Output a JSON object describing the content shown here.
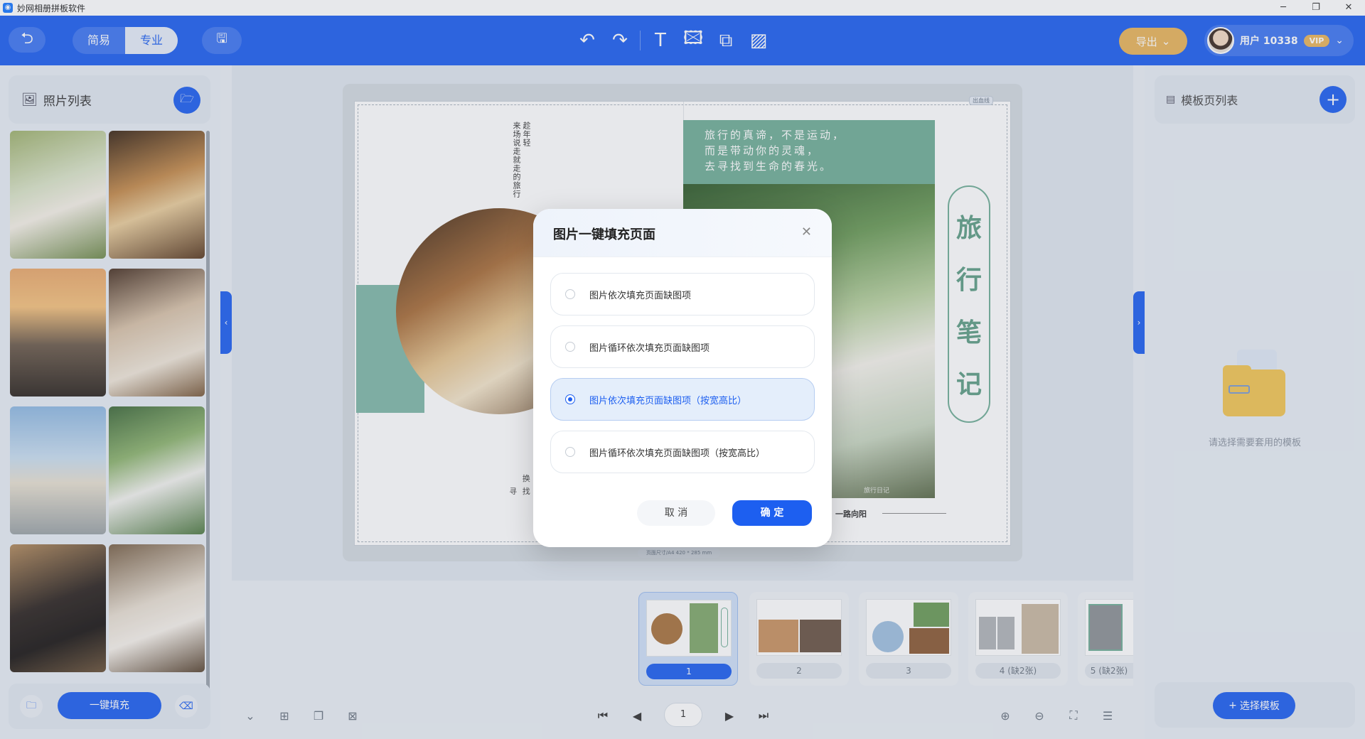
{
  "window": {
    "title": "妙网相册拼板软件",
    "minimize": "─",
    "restore": "❐",
    "close": "✕"
  },
  "toolbar": {
    "undo_icon": "⮌",
    "modes": [
      {
        "label": "简易"
      },
      {
        "label": "专业"
      }
    ],
    "save_icon": "🖫",
    "export_label": "导出",
    "export_chevron": "⌄",
    "user_name": "用户 10338",
    "vip_label": "VIP",
    "user_chevron": "⌄",
    "tools": {
      "undo": "↶",
      "redo": "↷",
      "text": "T",
      "image": "🖾",
      "shape": "⧉",
      "pattern": "▨"
    }
  },
  "left_panel": {
    "title": "照片列表",
    "fill_label": "一键填充"
  },
  "right_panel": {
    "title": "模板页列表",
    "empty_text": "请选择需要套用的模板",
    "choose_label": "选择模板"
  },
  "page": {
    "bleed_tag": "出血线",
    "size_tag": "页面尺寸/A4 420 * 285 mm",
    "vertical_text": [
      "趁年轻",
      "来场说走就走的旅行"
    ],
    "caption_left": [
      "换 一 种 方",
      "寻 找 另 一 面 的"
    ],
    "quote": [
      "旅行的真谛，不是运动，",
      "而是带动你的灵魂，",
      "去寻找到生命的春光。"
    ],
    "title_chars": [
      "旅",
      "行",
      "笔",
      "记"
    ],
    "signature": "一路向阳",
    "watermark": "旅行日记"
  },
  "thumbnails": [
    {
      "label": "1",
      "active": true
    },
    {
      "label": "2",
      "active": false
    },
    {
      "label": "3",
      "active": false
    },
    {
      "label": "4 (缺2张)",
      "active": false
    },
    {
      "label": "5 (缺2张)",
      "active": false
    }
  ],
  "bottom_nav": {
    "page_value": "1"
  },
  "modal": {
    "title": "图片一键填充页面",
    "close_icon": "✕",
    "options": [
      {
        "label": "图片依次填充页面缺图项",
        "selected": false
      },
      {
        "label": "图片循环依次填充页面缺图项",
        "selected": false
      },
      {
        "label": "图片依次填充页面缺图项（按宽高比）",
        "selected": true
      },
      {
        "label": "图片循环依次填充页面缺图项（按宽高比）",
        "selected": false
      }
    ],
    "cancel_label": "取 消",
    "ok_label": "确 定"
  },
  "colors": {
    "primary": "#1d5ff0",
    "accent_gold": "#e8b45a",
    "teal": "#6fae96"
  }
}
